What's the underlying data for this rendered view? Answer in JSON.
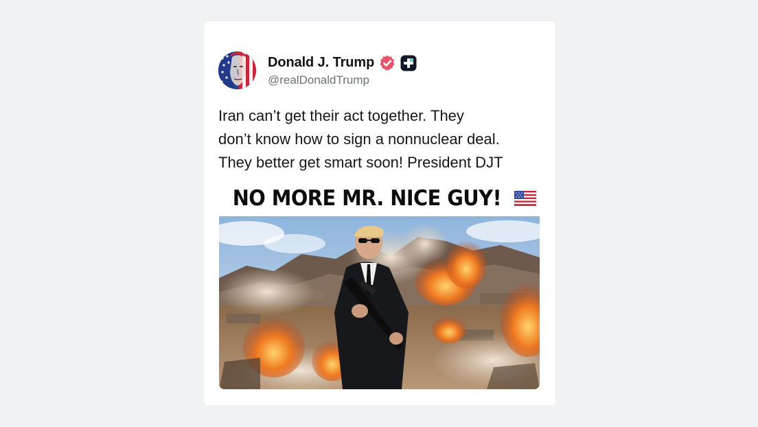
{
  "post": {
    "author": {
      "display_name": "Donald J. Trump",
      "handle": "@realDonaldTrump",
      "avatar_icon": "american-flag-portrait-avatar",
      "verified_icon": "verified-badge-icon",
      "extra_badge_icon": "plus-badge-icon"
    },
    "text": "Iran can’t get their act together. They\ndon’t know how to sign a nonnuclear deal.\nThey better get smart soon! President DJT",
    "media": {
      "headline": "NO MORE MR. NICE GUY!",
      "headline_emoji": "us-flag-icon",
      "image_icon": "desert-explosions-scene-image"
    }
  },
  "colors": {
    "page_background": "#f1f2f4",
    "card_background": "#ffffff",
    "verified_badge": "#e8546a",
    "plus_badge": "#111827",
    "handle_text": "#6b6f76"
  }
}
